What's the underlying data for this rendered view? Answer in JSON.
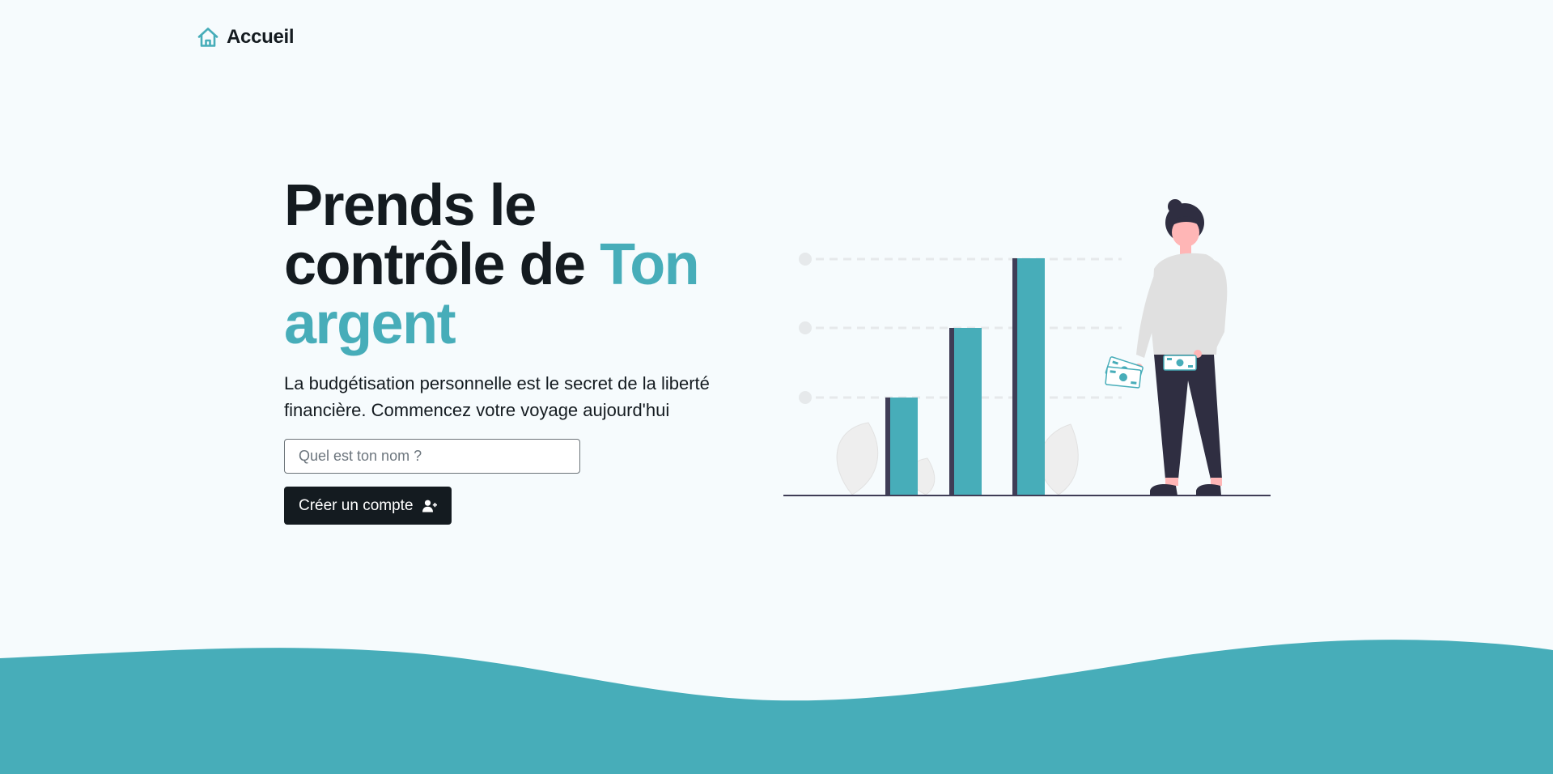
{
  "nav": {
    "home_label": "Accueil",
    "home_icon": "home-icon"
  },
  "hero": {
    "title_line1": "Prends le",
    "title_line2": "contrôle de ",
    "title_highlight1": "Ton",
    "title_highlight2": "argent",
    "subtitle": "La budgétisation personnelle est le secret de la liberté financière. Commencez votre voyage aujourd'hui",
    "name_input": {
      "placeholder": "Quel est ton nom ?",
      "value": ""
    },
    "cta_label": "Créer un compte",
    "cta_icon": "user-plus-icon"
  },
  "colors": {
    "accent": "#47adb9",
    "dark": "#141b20",
    "background": "#f6fbfd",
    "figure_dark": "#2f2e41",
    "skin": "#ffb6b6",
    "sweater": "#e0e0e0"
  }
}
